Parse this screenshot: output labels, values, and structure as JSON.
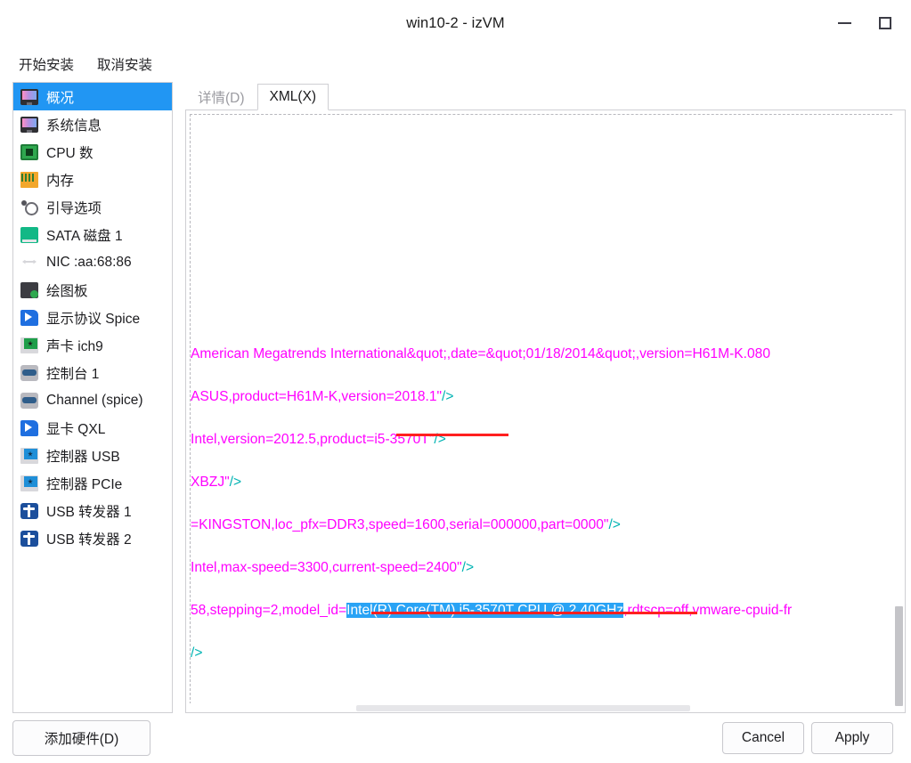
{
  "window": {
    "title": "win10-2 - izVM",
    "controls": [
      {
        "name": "minimize",
        "glyph": "minimize-icon"
      },
      {
        "name": "maximize",
        "glyph": "maximize-icon"
      }
    ]
  },
  "menubar": {
    "items": [
      {
        "label": "开始安装",
        "name": "begin-install"
      },
      {
        "label": "取消安装",
        "name": "cancel-install"
      }
    ]
  },
  "sidebar": {
    "items": [
      {
        "label": "概况",
        "icon": "monitor-icon",
        "icon_class": "ico-monitor",
        "selected": true
      },
      {
        "label": "系统信息",
        "icon": "monitor-icon",
        "icon_class": "ico-monitor",
        "selected": false
      },
      {
        "label": "CPU 数",
        "icon": "cpu-icon",
        "icon_class": "ico-cpu",
        "selected": false
      },
      {
        "label": "内存",
        "icon": "memory-icon",
        "icon_class": "ico-mem",
        "selected": false
      },
      {
        "label": "引导选项",
        "icon": "boot-options-icon",
        "icon_class": "ico-boot",
        "selected": false
      },
      {
        "label": "SATA 磁盘 1",
        "icon": "disk-icon",
        "icon_class": "ico-disk",
        "selected": false
      },
      {
        "label": "NIC :aa:68:86",
        "icon": "network-icon",
        "icon_class": "ico-nic",
        "selected": false
      },
      {
        "label": "绘图板",
        "icon": "tablet-icon",
        "icon_class": "ico-tablet",
        "selected": false
      },
      {
        "label": "显示协议 Spice",
        "icon": "display-icon",
        "icon_class": "ico-spice",
        "selected": false
      },
      {
        "label": "声卡 ich9",
        "icon": "sound-card-icon",
        "icon_class": "ico-sound",
        "selected": false
      },
      {
        "label": "控制台 1",
        "icon": "console-icon",
        "icon_class": "ico-console",
        "selected": false
      },
      {
        "label": "Channel (spice)",
        "icon": "console-icon",
        "icon_class": "ico-console",
        "selected": false
      },
      {
        "label": "显卡 QXL",
        "icon": "video-icon",
        "icon_class": "ico-spice",
        "selected": false
      },
      {
        "label": "控制器 USB",
        "icon": "controller-icon",
        "icon_class": "ico-ctrl",
        "selected": false
      },
      {
        "label": "控制器 PCIe",
        "icon": "controller-icon",
        "icon_class": "ico-ctrl",
        "selected": false
      },
      {
        "label": "USB 转发器 1",
        "icon": "usb-icon",
        "icon_class": "ico-usb",
        "selected": false
      },
      {
        "label": "USB 转发器 2",
        "icon": "usb-icon",
        "icon_class": "ico-usb",
        "selected": false
      }
    ]
  },
  "tabs": [
    {
      "label": "详情(D)",
      "name": "tab-details",
      "active": false
    },
    {
      "label": "XML(X)",
      "name": "tab-xml",
      "active": true
    }
  ],
  "xml": {
    "lines": [
      {
        "blank": true
      },
      {
        "blank": true
      },
      {
        "blank": true
      },
      {
        "blank": true
      },
      {
        "blank": true
      },
      {
        "segments": [
          {
            "text": "American Megatrends International&quot;,date=&quot;01/18/2014&quot;,version=H61M-K.080",
            "color": "pink"
          }
        ]
      },
      {
        "segments": [
          {
            "text": "ASUS,product=H61M-K,version=2018.1\"",
            "color": "pink"
          },
          {
            "text": "/>",
            "color": "teal"
          }
        ]
      },
      {
        "segments": [
          {
            "text": "Intel,version=2012.5,product=",
            "color": "pink"
          },
          {
            "text": "i5-3570T\"",
            "color": "pink"
          },
          {
            "text": "/>",
            "color": "teal"
          }
        ]
      },
      {
        "segments": [
          {
            "text": "XBZJ\"",
            "color": "pink"
          },
          {
            "text": "/>",
            "color": "teal"
          }
        ]
      },
      {
        "segments": [
          {
            "text": "=KINGSTON,loc_pfx=DDR3,speed=1600,serial=000000,part=0000\"",
            "color": "pink"
          },
          {
            "text": "/>",
            "color": "teal"
          }
        ]
      },
      {
        "segments": [
          {
            "text": "Intel,max-speed=3300,current-speed=2400\"",
            "color": "pink"
          },
          {
            "text": "/>",
            "color": "teal"
          }
        ]
      },
      {
        "segments": [
          {
            "text": "58,stepping=2,model_id=",
            "color": "pink"
          },
          {
            "text": "Intel(R) Core(TM) i5-3570T CPU @ 2.40GHz",
            "color": "selected"
          },
          {
            "text": ",rdtscp=off,vmware-cpuid-fr",
            "color": "pink"
          }
        ]
      },
      {
        "segments": [
          {
            "text": "/>",
            "color": "teal"
          }
        ]
      }
    ],
    "annotations": {
      "underline_color": "#ff2020",
      "selection_color": "#29a3f5",
      "selected_text": "Intel(R) Core(TM) i5-3570T CPU @ 2.40GHz",
      "underlined_text_1": "=i5-3570T\"",
      "underlined_text_2": "Intel(R) Core(TM) i5-3570T CPU @ 2.40GHz"
    }
  },
  "footer": {
    "add_hardware": "添加硬件(D)",
    "cancel": "Cancel",
    "apply": "Apply"
  }
}
